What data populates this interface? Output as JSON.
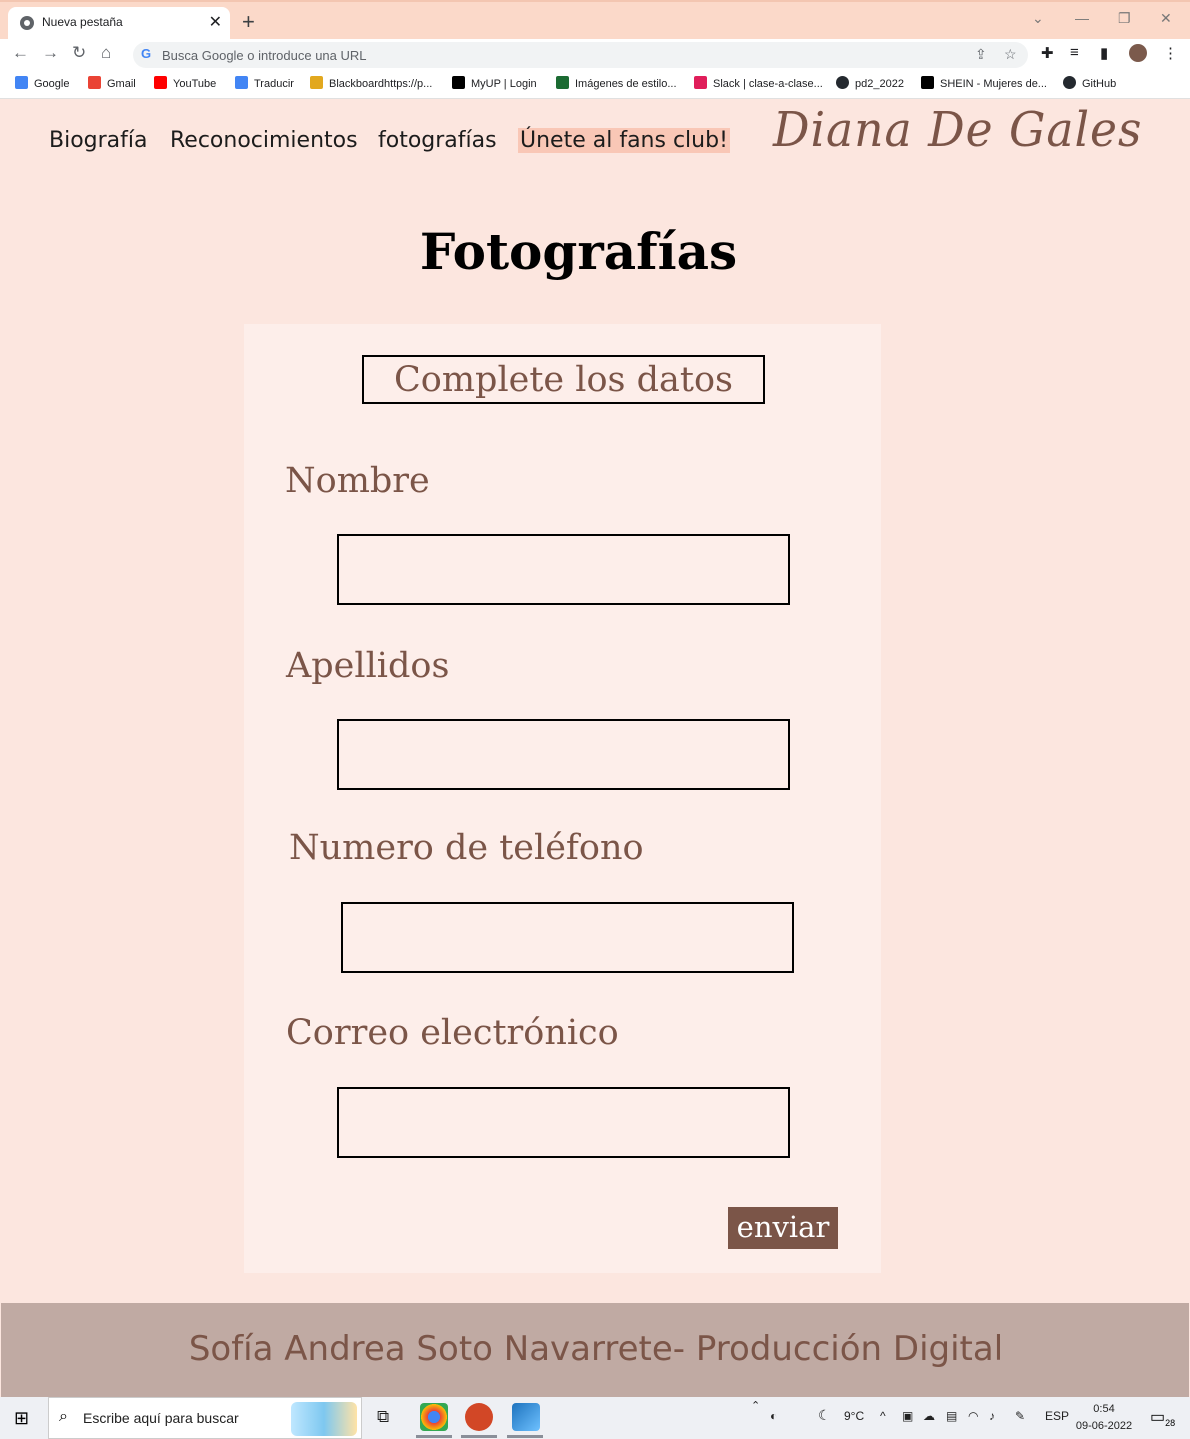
{
  "browser": {
    "tab_title": "Nueva pestaña",
    "omnibox_placeholder": "Busca Google o introduce una URL",
    "bookmarks": [
      {
        "label": "Google",
        "color": "#4285f4"
      },
      {
        "label": "Gmail",
        "color": "#ea4335"
      },
      {
        "label": "YouTube",
        "color": "#ff0000"
      },
      {
        "label": "Traducir",
        "color": "#4285f4"
      },
      {
        "label": "Blackboardhttps://p...",
        "color": "#e2a81e"
      },
      {
        "label": "MyUP | Login",
        "color": "#000000"
      },
      {
        "label": "Imágenes de estilo...",
        "color": "#1b6b32"
      },
      {
        "label": "Slack | clase-a-clase...",
        "color": "#e01e5a"
      },
      {
        "label": "pd2_2022",
        "color": "#24292f"
      },
      {
        "label": "SHEIN - Mujeres de...",
        "color": "#000000"
      },
      {
        "label": "GitHub",
        "color": "#24292f"
      }
    ]
  },
  "nav": {
    "biografia": "Biografía",
    "reconocimientos": "Reconocimientos",
    "fotografias": "fotografías",
    "fans": "Únete al fans club!"
  },
  "logo": "Diana De Gales",
  "page_title": "Fotografías",
  "form": {
    "title": "Complete los datos",
    "fields": {
      "nombre": "Nombre",
      "apellidos": "Apellidos",
      "telefono": "Numero de teléfono",
      "correo": "Correo electrónico"
    },
    "submit": "enviar"
  },
  "footer": "Sofía Andrea Soto Navarrete- Producción Digital",
  "taskbar": {
    "search_placeholder": "Escribe aquí para buscar",
    "weather": "9°C",
    "lang": "ESP",
    "time": "0:54",
    "date": "09-06-2022",
    "notifications": "28"
  },
  "colors": {
    "accent": "#7b5548",
    "page_bg": "#fce6df",
    "card_bg": "#fdeeea",
    "footer_bg": "#c0aaa3",
    "fans_highlight": "#f9c7b6"
  }
}
